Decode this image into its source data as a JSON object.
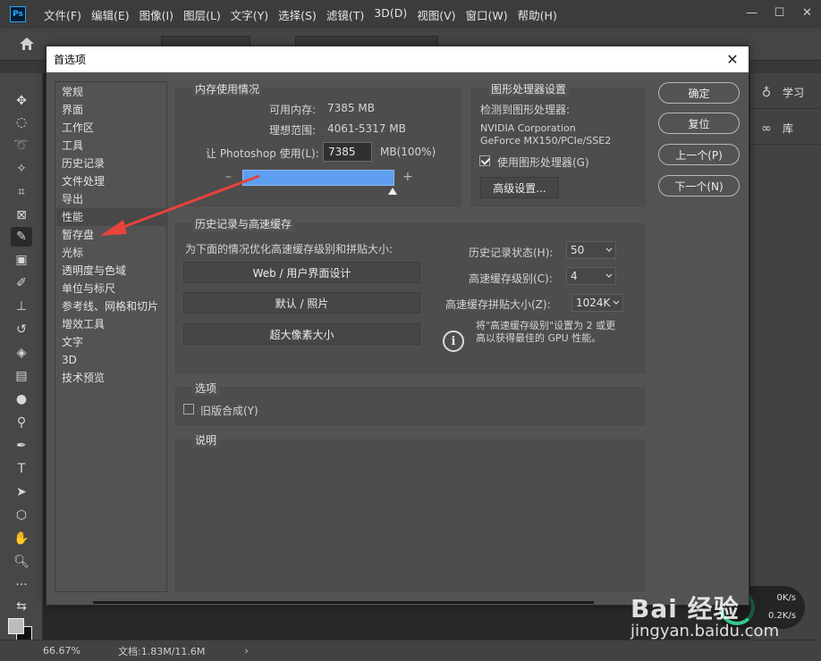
{
  "app": {
    "logo": "Ps"
  },
  "menu": [
    "文件(F)",
    "编辑(E)",
    "图像(I)",
    "图层(L)",
    "文字(Y)",
    "选择(S)",
    "滤镜(T)",
    "3D(D)",
    "视图(V)",
    "窗口(W)",
    "帮助(H)"
  ],
  "dialog": {
    "title": "首选项",
    "nav_items": [
      "常规",
      "界面",
      "工作区",
      "工具",
      "历史记录",
      "文件处理",
      "导出",
      "性能",
      "暂存盘",
      "光标",
      "透明度与色域",
      "单位与标尺",
      "参考线、网格和切片",
      "增效工具",
      "文字",
      "3D",
      "技术预览"
    ],
    "selected_nav": "性能",
    "memory": {
      "group_title": "内存使用情况",
      "available_label": "可用内存:",
      "available_value": "7385 MB",
      "ideal_label": "理想范围:",
      "ideal_value": "4061-5317 MB",
      "let_label": "让 Photoshop 使用(L):",
      "let_value": "7385",
      "let_unit": "MB(100%)",
      "slider_fraction": 1.0,
      "minus": "–",
      "plus": "+"
    },
    "gpu": {
      "group_title": "图形处理器设置",
      "detected_label": "检测到图形处理器:",
      "vendor": "NVIDIA Corporation",
      "model": "GeForce MX150/PCIe/SSE2",
      "use_gpu_label": "使用图形处理器(G)",
      "use_gpu_checked": true,
      "advanced_button": "高级设置..."
    },
    "history": {
      "group_title": "历史记录与高速缓存",
      "optimize_label": "为下面的情况优化高速缓存级别和拼贴大小:",
      "preset_web": "Web / 用户界面设计",
      "preset_default": "默认 / 照片",
      "preset_huge": "超大像素大小",
      "history_states_label": "历史记录状态(H):",
      "history_states_value": "50",
      "cache_levels_label": "高速缓存级别(C):",
      "cache_levels_value": "4",
      "tile_size_label": "高速缓存拼贴大小(Z):",
      "tile_size_value": "1024K",
      "info_line1": "将\"高速缓存级别\"设置为 2 或更",
      "info_line2": "高以获得最佳的 GPU 性能。"
    },
    "options": {
      "group_title": "选项",
      "legacy_label": "旧版合成(Y)",
      "legacy_checked": false
    },
    "description": {
      "group_title": "说明"
    },
    "buttons": {
      "ok": "确定",
      "reset": "复位",
      "prev": "上一个(P)",
      "next": "下一个(N)"
    }
  },
  "right_panel": {
    "learn": "学习",
    "library": "库"
  },
  "status": {
    "zoom": "66.67%",
    "doc": "文档:1.83M/11.6M",
    "arrow": "›"
  },
  "network": {
    "up": "0K/s",
    "down": "0.2K/s"
  },
  "watermark": {
    "brand": "Bai 经验",
    "url": "jingyan.baidu.com"
  },
  "colors": {
    "accent_arrow": "#e8423c",
    "slider_fill": "#5d9ef0"
  }
}
